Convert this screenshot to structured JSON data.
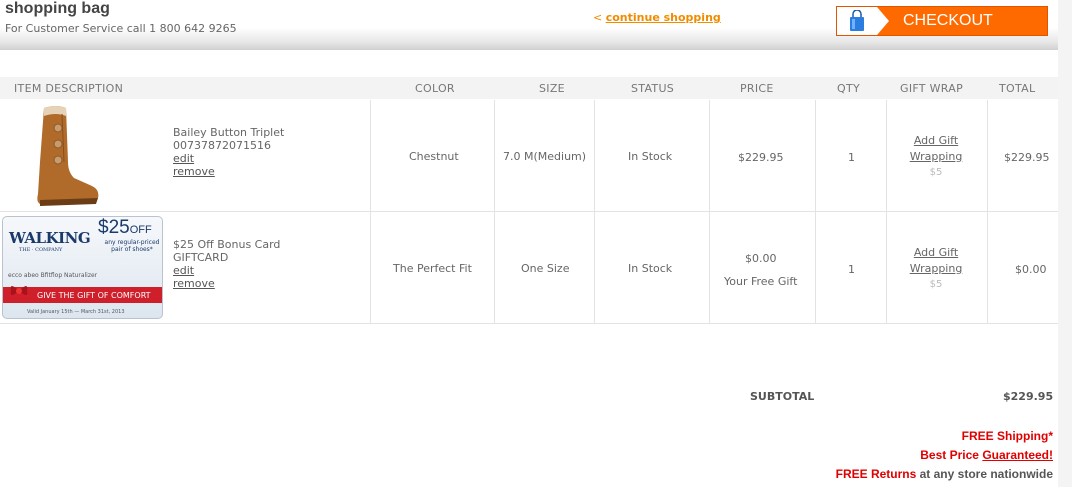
{
  "header": {
    "title": "shopping bag",
    "service": "For Customer Service call 1 800 642 9265",
    "continue_prefix": "<",
    "continue_label": "continue shopping",
    "checkout_label": "CHECKOUT"
  },
  "columns": [
    "ITEM DESCRIPTION",
    "COLOR",
    "SIZE",
    "STATUS",
    "PRICE",
    "QTY",
    "GIFT WRAP",
    "TOTAL"
  ],
  "items": [
    {
      "name": "Bailey Button Triplet",
      "sku": "00737872071516",
      "edit": "edit",
      "remove": "remove",
      "color": "Chestnut",
      "size": "7.0 M(Medium)",
      "status": "In Stock",
      "price": "$229.95",
      "price_note": "",
      "qty": "1",
      "gift_line1": "Add Gift",
      "gift_line2": "Wrapping",
      "gift_price": "$5",
      "total": "$229.95"
    },
    {
      "name": "$25 Off Bonus Card",
      "sku": "GIFTCARD",
      "edit": "edit",
      "remove": "remove",
      "color": "The Perfect Fit",
      "size": "One Size",
      "status": "In Stock",
      "price": "$0.00",
      "price_note": "Your Free Gift",
      "qty": "1",
      "gift_line1": "Add Gift",
      "gift_line2": "Wrapping",
      "gift_price": "$5",
      "total": "$0.00"
    }
  ],
  "card_art": {
    "brand": "WALKING",
    "brand_small": "THE · COMPANY",
    "off_big": "$25",
    "off_small": "OFF",
    "sub": "any regular-priced pair of shoes*",
    "brands": "ecco  abeo  Bfitflop  Naturalizer",
    "ribbon": "GIVE THE GIFT OF COMFORT",
    "valid": "Valid January 15th — March 31st, 2013"
  },
  "summary": {
    "subtotal_label": "SUBTOTAL",
    "subtotal_value": "$229.95"
  },
  "promos": {
    "free_shipping": "FREE Shipping*",
    "best_price": "Best Price",
    "guaranteed": "Guaranteed!",
    "free_returns": "FREE Returns",
    "returns_rest": " at any store nationwide"
  },
  "colors": {
    "accent": "#ff6a00",
    "promo_red": "#e00000",
    "link_orange": "#f08c00"
  }
}
